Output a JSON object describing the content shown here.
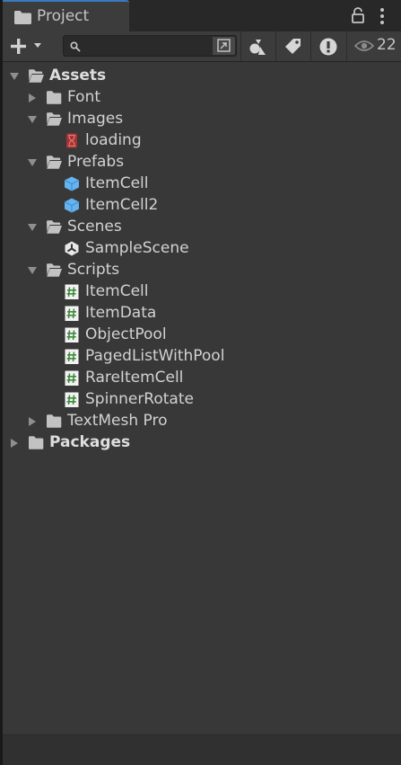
{
  "tab": {
    "label": "Project",
    "icon": "folder-icon"
  },
  "toolbar": {
    "create_icon": "plus-icon",
    "search_value": "",
    "search_placeholder": "",
    "visibility_count": "22"
  },
  "tree": [
    {
      "label": "Assets",
      "depth": 0,
      "state": "expanded",
      "icon": "folder-open-icon",
      "bold": true
    },
    {
      "label": "Font",
      "depth": 1,
      "state": "collapsed",
      "icon": "folder-icon"
    },
    {
      "label": "Images",
      "depth": 1,
      "state": "expanded",
      "icon": "folder-open-icon"
    },
    {
      "label": "loading",
      "depth": 2,
      "state": "leaf",
      "icon": "sprite-icon"
    },
    {
      "label": "Prefabs",
      "depth": 1,
      "state": "expanded",
      "icon": "folder-open-icon"
    },
    {
      "label": "ItemCell",
      "depth": 2,
      "state": "leaf",
      "icon": "prefab-icon"
    },
    {
      "label": "ItemCell2",
      "depth": 2,
      "state": "leaf",
      "icon": "prefab-icon"
    },
    {
      "label": "Scenes",
      "depth": 1,
      "state": "expanded",
      "icon": "folder-open-icon"
    },
    {
      "label": "SampleScene",
      "depth": 2,
      "state": "leaf",
      "icon": "unity-scene-icon"
    },
    {
      "label": "Scripts",
      "depth": 1,
      "state": "expanded",
      "icon": "folder-open-icon"
    },
    {
      "label": "ItemCell",
      "depth": 2,
      "state": "leaf",
      "icon": "csharp-script-icon"
    },
    {
      "label": "ItemData",
      "depth": 2,
      "state": "leaf",
      "icon": "csharp-script-icon"
    },
    {
      "label": "ObjectPool",
      "depth": 2,
      "state": "leaf",
      "icon": "csharp-script-icon"
    },
    {
      "label": "PagedListWithPool",
      "depth": 2,
      "state": "leaf",
      "icon": "csharp-script-icon"
    },
    {
      "label": "RareItemCell",
      "depth": 2,
      "state": "leaf",
      "icon": "csharp-script-icon"
    },
    {
      "label": "SpinnerRotate",
      "depth": 2,
      "state": "leaf",
      "icon": "csharp-script-icon"
    },
    {
      "label": "TextMesh Pro",
      "depth": 1,
      "state": "collapsed",
      "icon": "folder-icon"
    },
    {
      "label": "Packages",
      "depth": 0,
      "state": "collapsed",
      "icon": "folder-icon",
      "bold": true
    }
  ]
}
